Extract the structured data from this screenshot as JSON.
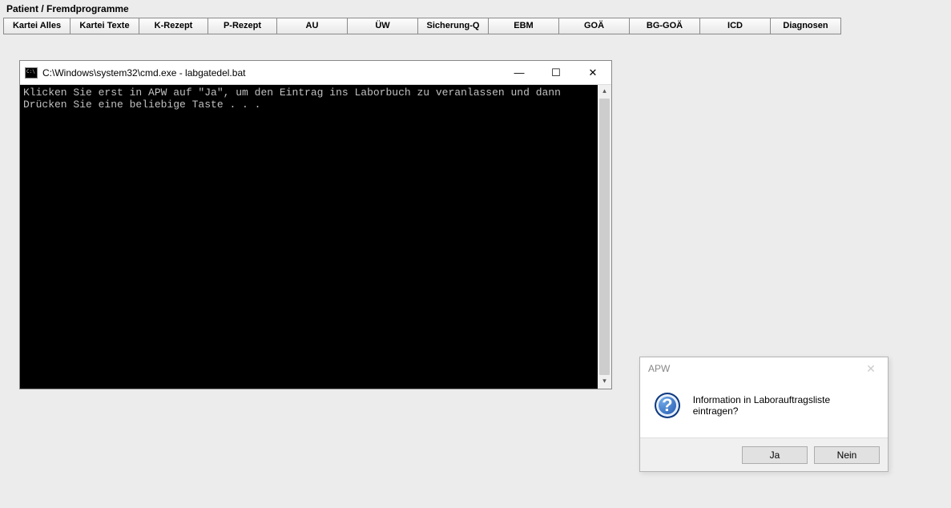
{
  "header": {
    "title": "Patient / Fremdprogramme"
  },
  "toolbar": {
    "buttons": [
      "Kartei Alles",
      "Kartei Texte",
      "K-Rezept",
      "P-Rezept",
      "AU",
      "ÜW",
      "Sicherung-Q",
      "EBM",
      "GOÄ",
      "BG-GOÄ",
      "ICD",
      "Diagnosen"
    ]
  },
  "cmd": {
    "title": "C:\\Windows\\system32\\cmd.exe - labgatedel.bat",
    "body_line1": "Klicken Sie erst in APW auf \"Ja\", um den Eintrag ins Laborbuch zu veranlassen und dann",
    "body_line2": "Drücken Sie eine beliebige Taste . . .",
    "minimize": "—",
    "maximize": "☐",
    "close": "✕"
  },
  "dialog": {
    "title": "APW",
    "message": "Information in Laborauftragsliste eintragen?",
    "yes_label": "Ja",
    "no_label": "Nein",
    "close": "✕",
    "question_mark": "?"
  }
}
